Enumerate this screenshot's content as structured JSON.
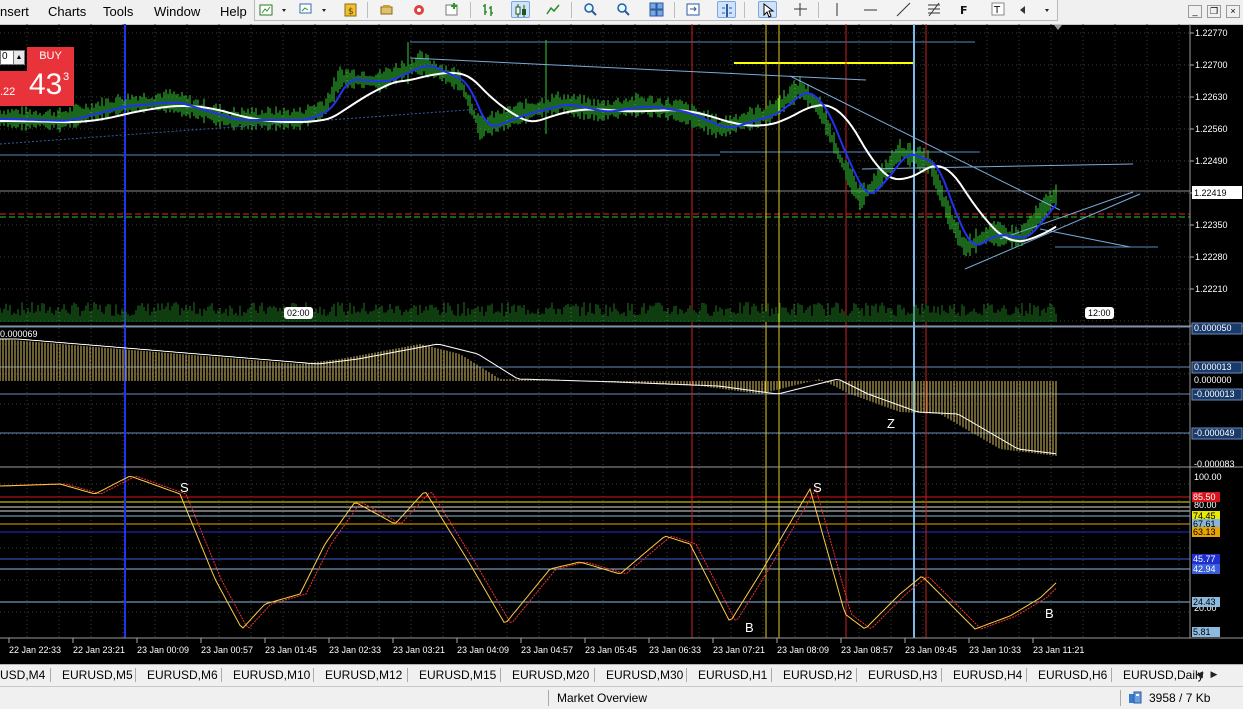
{
  "menu": {
    "items": [
      "nsert",
      "Charts",
      "Tools",
      "Window",
      "Help"
    ]
  },
  "toolbar": {
    "icons": [
      "new-chart-icon",
      "profiles-icon",
      "market-watch-icon",
      "navigator-icon",
      "terminal-icon",
      "strategy-tester-icon",
      "new-order-icon",
      "bar-chart-icon",
      "candlestick-icon",
      "line-chart-icon",
      "zoom-in-icon",
      "zoom-out-icon",
      "tile-windows-icon",
      "auto-scroll-icon",
      "chart-shift-icon",
      "cursor-icon",
      "crosshair-icon",
      "vertical-line-icon",
      "horizontal-line-icon",
      "trendline-icon",
      "fibonacci-icon",
      "text-icon",
      "text-label-icon",
      "more-tools-icon"
    ]
  },
  "one_click": {
    "lots": "0",
    "side": "BUY",
    "price_small": ".22",
    "price_big": "43",
    "price_sup": "3"
  },
  "price_scale": {
    "labels": [
      "1.22770",
      "1.22700",
      "1.22630",
      "1.22560",
      "1.22490",
      "1.22420",
      "1.22350",
      "1.22280",
      "1.22210"
    ],
    "current": "1.22419"
  },
  "time_markers": [
    "02:00",
    "12:00"
  ],
  "macd": {
    "value_label": "0.000069",
    "scale": [
      "0.000050",
      "0.000013",
      "0.000000",
      "-0.000013",
      "-0.000049",
      "-0.000083"
    ],
    "annotation": "Z"
  },
  "stoch": {
    "scale": [
      "100.00",
      "80.00",
      "20.00"
    ],
    "levels": [
      {
        "label": "85.50",
        "bg": "#d7141a"
      },
      {
        "label": "74.45",
        "bg": "#e8e800"
      },
      {
        "label": "67.61",
        "bg": "#87b6d8"
      },
      {
        "label": "63.13",
        "bg": "#e8a400"
      },
      {
        "label": "45.77",
        "bg": "#1f2fcf"
      },
      {
        "label": "42.94",
        "bg": "#3a5fd8"
      },
      {
        "label": "24.43",
        "bg": "#8dbbe0"
      },
      {
        "label": "5.81",
        "bg": "#8dbbe0"
      }
    ],
    "annotations": [
      "S",
      "S",
      "B",
      "B"
    ]
  },
  "time_axis": [
    "22 Jan 22:33",
    "22 Jan 23:21",
    "23 Jan 00:09",
    "23 Jan 00:57",
    "23 Jan 01:45",
    "23 Jan 02:33",
    "23 Jan 03:21",
    "23 Jan 04:09",
    "23 Jan 04:57",
    "23 Jan 05:45",
    "23 Jan 06:33",
    "23 Jan 07:21",
    "23 Jan 08:09",
    "23 Jan 08:57",
    "23 Jan 09:45",
    "23 Jan 10:33",
    "23 Jan 11:21"
  ],
  "tabs": [
    "USD,M4",
    "EURUSD,M5",
    "EURUSD,M6",
    "EURUSD,M10",
    "EURUSD,M12",
    "EURUSD,M15",
    "EURUSD,M20",
    "EURUSD,M30",
    "EURUSD,H1",
    "EURUSD,H2",
    "EURUSD,H3",
    "EURUSD,H4",
    "EURUSD,H6",
    "EURUSD,Daily"
  ],
  "status": {
    "market": "Market Overview",
    "traffic": "3958 / 7 Kb"
  },
  "colors": {
    "candles": "#33cc33",
    "ma_fast": "#2233ee",
    "ma_slow": "#ffffff",
    "macd_hist": "#d8c060",
    "stoch_main": "#ffcc44",
    "stoch_signal": "#ee3333",
    "buy": "#e8333a"
  }
}
